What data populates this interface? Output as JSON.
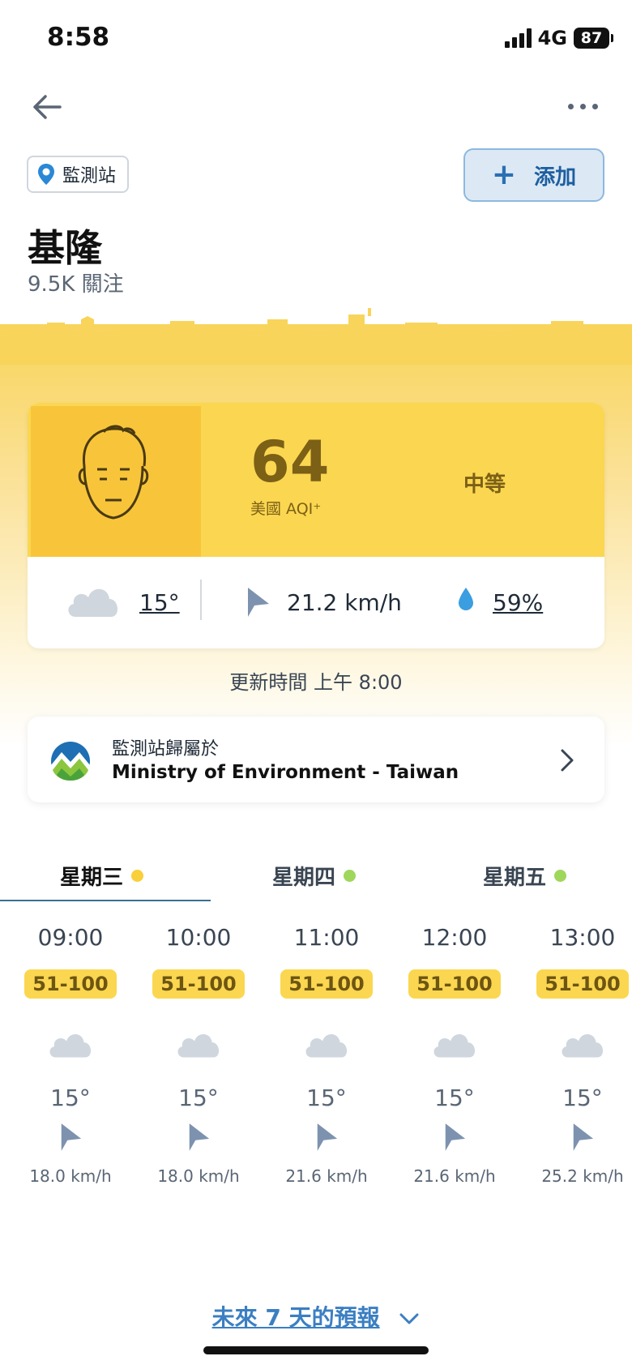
{
  "status_bar": {
    "time": "8:58",
    "network": "4G",
    "battery": "87"
  },
  "header": {
    "station_chip": "監測站",
    "add_label": "添加",
    "city": "基隆",
    "followers": "9.5K 關注"
  },
  "aqi": {
    "value": "64",
    "label": "美國 AQI⁺",
    "level": "中等",
    "color": "#fbd650"
  },
  "weather": {
    "temp": "15°",
    "wind": "21.2 km/h",
    "humidity": "59%"
  },
  "updated": "更新時間 上午 8:00",
  "owner": {
    "line1": "監測站歸屬於",
    "line2": "Ministry of Environment - Taiwan"
  },
  "days": [
    {
      "label": "星期三",
      "dot_color": "#f9cf3a",
      "selected": true
    },
    {
      "label": "星期四",
      "dot_color": "#9ed75b",
      "selected": false
    },
    {
      "label": "星期五",
      "dot_color": "#9ed75b",
      "selected": false
    }
  ],
  "hourly": [
    {
      "time": "09:00",
      "range": "51-100",
      "temp": "15°",
      "wind": "18.0 km/h"
    },
    {
      "time": "10:00",
      "range": "51-100",
      "temp": "15°",
      "wind": "18.0 km/h"
    },
    {
      "time": "11:00",
      "range": "51-100",
      "temp": "15°",
      "wind": "21.6 km/h"
    },
    {
      "time": "12:00",
      "range": "51-100",
      "temp": "15°",
      "wind": "21.6 km/h"
    },
    {
      "time": "13:00",
      "range": "51-100",
      "temp": "15°",
      "wind": "25.2 km/h"
    }
  ],
  "forecast_link": "未來 7 天的預報"
}
